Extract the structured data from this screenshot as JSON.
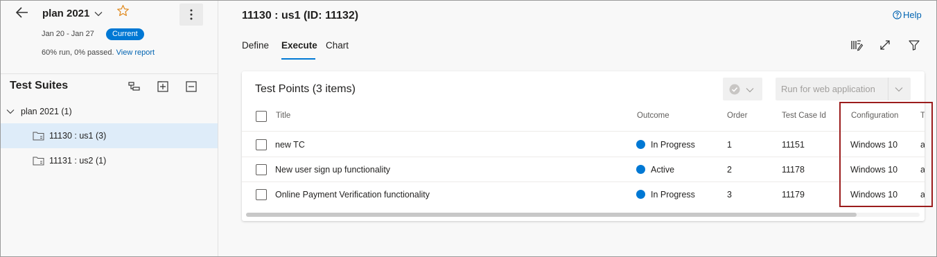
{
  "plan": {
    "name": "plan 2021",
    "date_range": "Jan 20 - Jan 27",
    "badge": "Current",
    "stats_text": "60% run, 0% passed.",
    "view_report_label": "View report"
  },
  "suites_panel": {
    "title": "Test Suites",
    "tree": [
      {
        "label": "plan 2021 (1)"
      },
      {
        "label": "11130 : us1 (3)"
      },
      {
        "label": "11131 : us2 (1)"
      }
    ]
  },
  "main": {
    "heading": "11130 : us1 (ID: 11132)",
    "help_label": "Help",
    "tabs": [
      {
        "label": "Define"
      },
      {
        "label": "Execute"
      },
      {
        "label": "Chart"
      }
    ],
    "active_tab": "Execute"
  },
  "test_points": {
    "title": "Test Points (3 items)",
    "run_button_label": "Run for web application",
    "columns": {
      "title": "Title",
      "outcome": "Outcome",
      "order": "Order",
      "test_case_id": "Test Case Id",
      "configuration": "Configuration",
      "extra": "T"
    },
    "rows": [
      {
        "title": "new TC",
        "outcome": "In Progress",
        "order": "1",
        "test_case_id": "11151",
        "configuration": "Windows 10",
        "extra": "a"
      },
      {
        "title": "New user sign up functionality",
        "outcome": "Active",
        "order": "2",
        "test_case_id": "11178",
        "configuration": "Windows 10",
        "extra": "a"
      },
      {
        "title": "Online Payment Verification functionality",
        "outcome": "In Progress",
        "order": "3",
        "test_case_id": "11179",
        "configuration": "Windows 10",
        "extra": "a"
      }
    ]
  },
  "colors": {
    "accent": "#0078d4",
    "status_dot": "#0078d4",
    "selected_row": "#deecf9",
    "highlight_box": "#9b1c1c",
    "star": "#e08a1e"
  },
  "icons": {
    "back": "arrow-left-icon",
    "favorite": "star-outline-icon",
    "more": "more-vertical-icon",
    "help": "help-circle-icon",
    "column_options": "column-options-icon",
    "fullscreen": "expand-icon",
    "filter": "filter-icon",
    "outcome": "check-circle-icon"
  }
}
